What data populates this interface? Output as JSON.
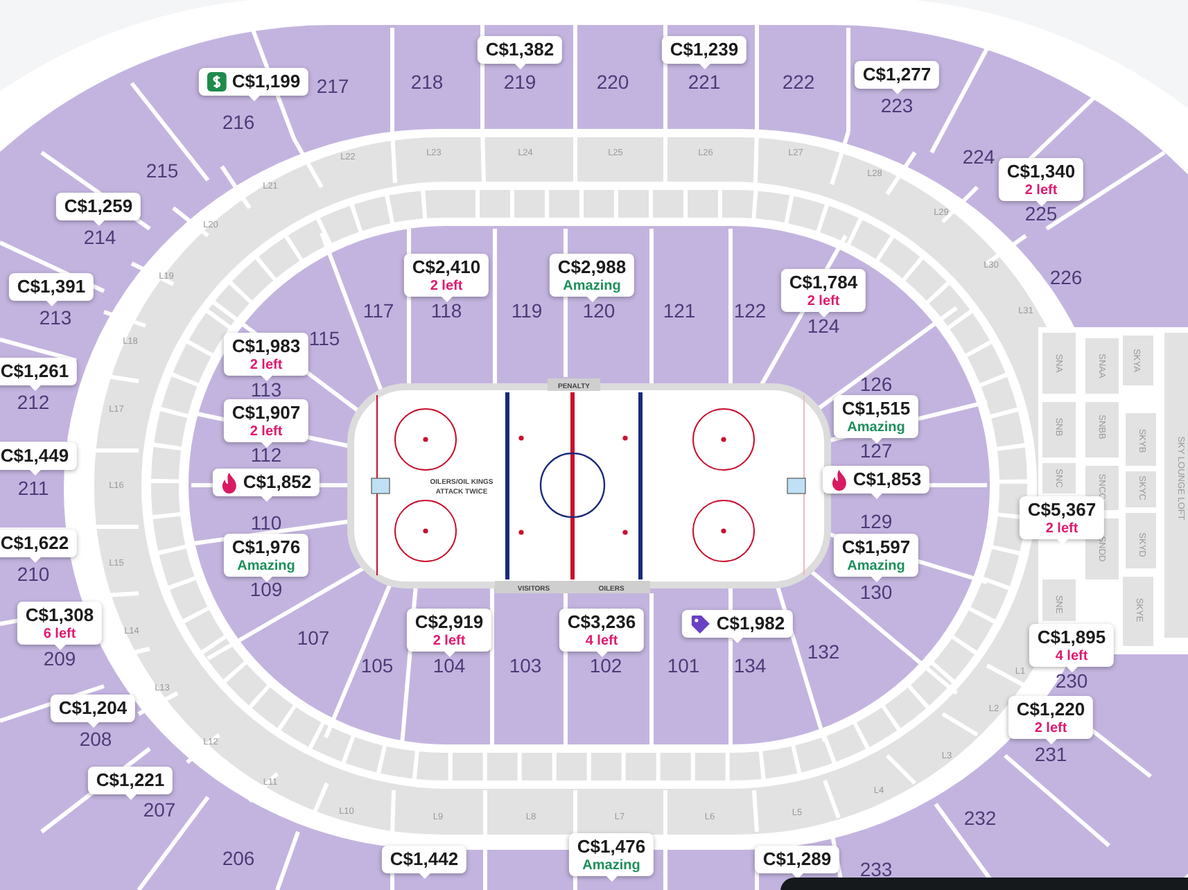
{
  "sections": [
    {
      "label": "217"
    },
    {
      "label": "218"
    },
    {
      "label": "219"
    },
    {
      "label": "220"
    },
    {
      "label": "221"
    },
    {
      "label": "222"
    },
    {
      "label": "223"
    },
    {
      "label": "216"
    },
    {
      "label": "224"
    },
    {
      "label": "215"
    },
    {
      "label": "225"
    },
    {
      "label": "214"
    },
    {
      "label": "226"
    },
    {
      "label": "213"
    },
    {
      "label": "212"
    },
    {
      "label": "211"
    },
    {
      "label": "210"
    },
    {
      "label": "209"
    },
    {
      "label": "208"
    },
    {
      "label": "207"
    },
    {
      "label": "206"
    },
    {
      "label": "233"
    },
    {
      "label": "232"
    },
    {
      "label": "231"
    },
    {
      "label": "230"
    },
    {
      "label": "117"
    },
    {
      "label": "118"
    },
    {
      "label": "119"
    },
    {
      "label": "120"
    },
    {
      "label": "121"
    },
    {
      "label": "122"
    },
    {
      "label": "115"
    },
    {
      "label": "124"
    },
    {
      "label": "113"
    },
    {
      "label": "126"
    },
    {
      "label": "112"
    },
    {
      "label": "127"
    },
    {
      "label": "110"
    },
    {
      "label": "129"
    },
    {
      "label": "109"
    },
    {
      "label": "130"
    },
    {
      "label": "107"
    },
    {
      "label": "132"
    },
    {
      "label": "105"
    },
    {
      "label": "104"
    },
    {
      "label": "103"
    },
    {
      "label": "102"
    },
    {
      "label": "101"
    },
    {
      "label": "134"
    }
  ],
  "loge_boxes": [
    {
      "label": "L22"
    },
    {
      "label": "L23"
    },
    {
      "label": "L24"
    },
    {
      "label": "L25"
    },
    {
      "label": "L26"
    },
    {
      "label": "L27"
    },
    {
      "label": "L28"
    },
    {
      "label": "L29"
    },
    {
      "label": "L30"
    },
    {
      "label": "L31"
    },
    {
      "label": "L21"
    },
    {
      "label": "L20"
    },
    {
      "label": "L19"
    },
    {
      "label": "L18"
    },
    {
      "label": "L17"
    },
    {
      "label": "L16"
    },
    {
      "label": "L15"
    },
    {
      "label": "L14"
    },
    {
      "label": "L13"
    },
    {
      "label": "L12"
    },
    {
      "label": "L11"
    },
    {
      "label": "L10"
    },
    {
      "label": "L9"
    },
    {
      "label": "L8"
    },
    {
      "label": "L7"
    },
    {
      "label": "L6"
    },
    {
      "label": "L5"
    },
    {
      "label": "L4"
    },
    {
      "label": "L3"
    },
    {
      "label": "L2"
    },
    {
      "label": "L1"
    }
  ],
  "suites": [
    {
      "label": "SNA"
    },
    {
      "label": "SNB"
    },
    {
      "label": "SNC"
    },
    {
      "label": "SNE"
    },
    {
      "label": "SNAA"
    },
    {
      "label": "SNBB"
    },
    {
      "label": "SNCC"
    },
    {
      "label": "SNDD"
    },
    {
      "label": "SKYA"
    },
    {
      "label": "SKYB"
    },
    {
      "label": "SKYC"
    },
    {
      "label": "SKYD"
    },
    {
      "label": "SKYE"
    },
    {
      "label": "SKY LOUNGE LOFT"
    }
  ],
  "rink": {
    "penalty_box": "PENALTY",
    "benches": [
      "VISITORS",
      "OILERS"
    ],
    "note": [
      "OILERS/OIL KINGS",
      "ATTACK TWICE"
    ]
  },
  "price_tags": [
    {
      "price": "C$1,199",
      "kind": "deal"
    },
    {
      "price": "C$1,382"
    },
    {
      "price": "C$1,239"
    },
    {
      "price": "C$1,277"
    },
    {
      "price": "C$1,340",
      "note": {
        "text": "2 left",
        "kind": "scarcity"
      }
    },
    {
      "price": "C$1,259"
    },
    {
      "price": "C$1,391"
    },
    {
      "price": "C$1,983",
      "note": {
        "text": "2 left",
        "kind": "scarcity"
      }
    },
    {
      "price": "C$2,410",
      "note": {
        "text": "2 left",
        "kind": "scarcity"
      }
    },
    {
      "price": "C$2,988",
      "note": {
        "text": "Amazing",
        "kind": "rating"
      }
    },
    {
      "price": "C$1,784",
      "note": {
        "text": "2 left",
        "kind": "scarcity"
      }
    },
    {
      "price": "C$1,261"
    },
    {
      "price": "C$1,907",
      "note": {
        "text": "2 left",
        "kind": "scarcity"
      }
    },
    {
      "price": "C$1,515",
      "note": {
        "text": "Amazing",
        "kind": "rating"
      }
    },
    {
      "price": "C$1,449"
    },
    {
      "price": "C$1,852",
      "kind": "hot"
    },
    {
      "price": "C$1,853",
      "kind": "hot"
    },
    {
      "price": "C$5,367",
      "note": {
        "text": "2 left",
        "kind": "scarcity"
      }
    },
    {
      "price": "C$1,622"
    },
    {
      "price": "C$1,976",
      "note": {
        "text": "Amazing",
        "kind": "rating"
      }
    },
    {
      "price": "C$1,597",
      "note": {
        "text": "Amazing",
        "kind": "rating"
      }
    },
    {
      "price": "C$1,308",
      "note": {
        "text": "6 left",
        "kind": "scarcity"
      }
    },
    {
      "price": "C$2,919",
      "note": {
        "text": "2 left",
        "kind": "scarcity"
      }
    },
    {
      "price": "C$3,236",
      "note": {
        "text": "4 left",
        "kind": "scarcity"
      }
    },
    {
      "price": "C$1,982",
      "kind": "promo"
    },
    {
      "price": "C$1,895",
      "note": {
        "text": "4 left",
        "kind": "scarcity"
      }
    },
    {
      "price": "C$1,204"
    },
    {
      "price": "C$1,220",
      "note": {
        "text": "2 left",
        "kind": "scarcity"
      }
    },
    {
      "price": "C$1,221"
    },
    {
      "price": "C$1,442"
    },
    {
      "price": "C$1,476",
      "note": {
        "text": "Amazing",
        "kind": "rating"
      }
    },
    {
      "price": "C$1,289"
    }
  ]
}
